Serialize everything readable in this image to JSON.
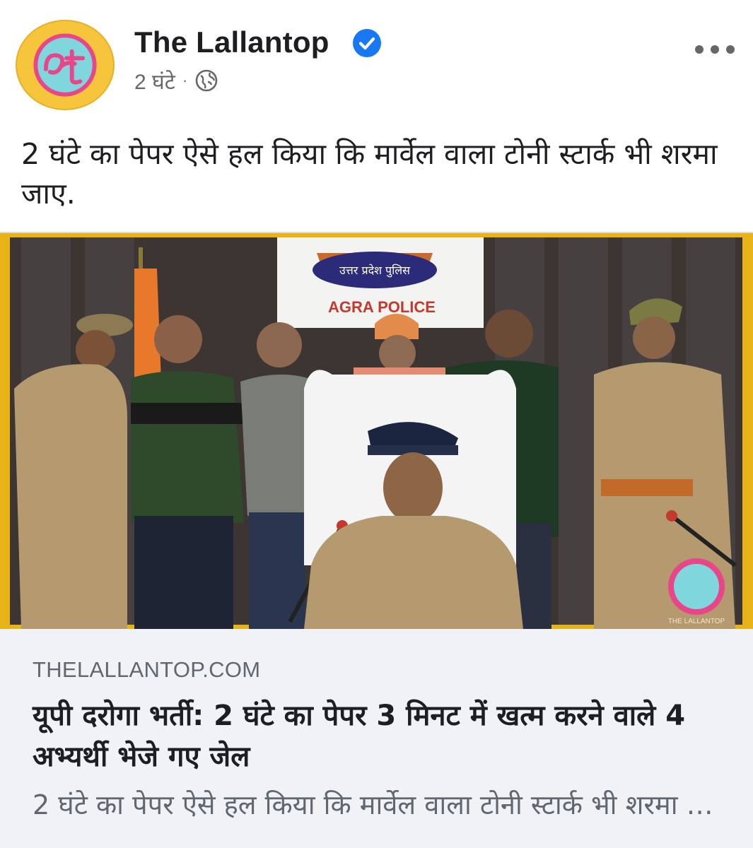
{
  "post": {
    "page_name": "The Lallantop",
    "timestamp": "2 घंटे",
    "separator": "·",
    "privacy_icon": "globe-icon",
    "verified_icon": "verified-badge-icon",
    "more_icon": "more-options-icon",
    "caption": "2 घंटे का पेपर ऐसे हल किया कि मार्वेल वाला टोनी स्टार्क भी शरमा जाए."
  },
  "photo": {
    "sign_text": "AGRA POLICE",
    "badge_text": "उत्तर प्रदेश पुलिस",
    "watermark": "THE LALLANTOP"
  },
  "link": {
    "domain": "THELALLANTOP.COM",
    "title": "यूपी दरोगा भर्ती: 2 घंटे का पेपर 3 मिनट में खत्म करने वाले 4 अभ्यर्थी भेजे गए जेल",
    "description": "2 घंटे का पेपर ऐसे हल किया कि मार्वेल वाला टोनी स्टार्क भी शरमा जाए."
  },
  "colors": {
    "verified_blue": "#1877f2",
    "meta_gray": "#65676b",
    "card_bg": "#f0f2f5",
    "police_khaki": "#b49a6e"
  }
}
